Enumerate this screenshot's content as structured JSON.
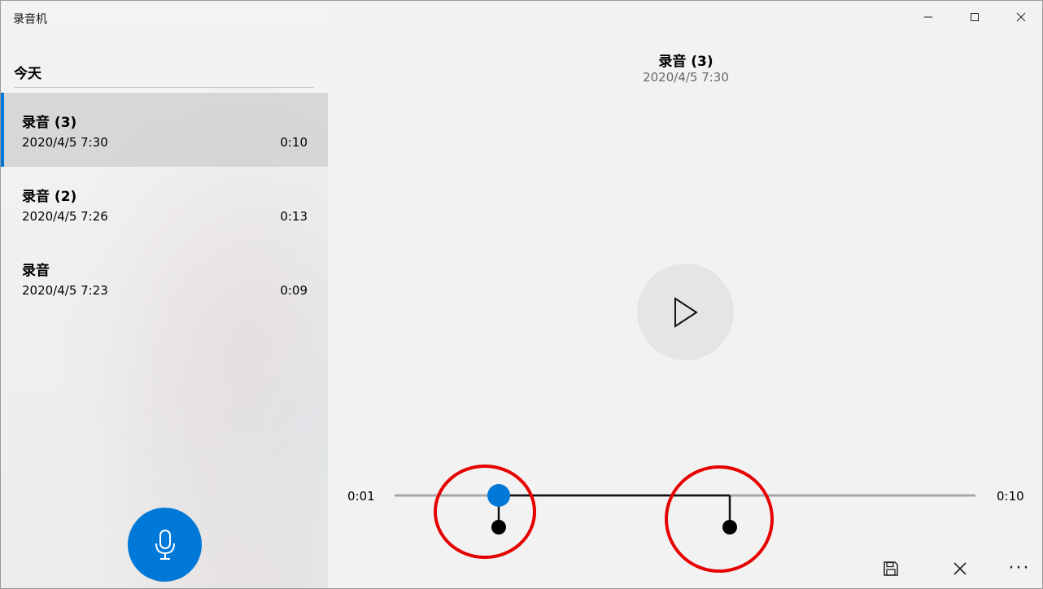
{
  "app": {
    "title": "录音机"
  },
  "sidebar": {
    "section_header": "今天",
    "recordings": [
      {
        "name": "录音 (3)",
        "date": "2020/4/5 7:30",
        "duration": "0:10",
        "selected": true
      },
      {
        "name": "录音 (2)",
        "date": "2020/4/5 7:26",
        "duration": "0:13",
        "selected": false
      },
      {
        "name": "录音",
        "date": "2020/4/5 7:23",
        "duration": "0:09",
        "selected": false
      }
    ],
    "record_button_icon": "microphone-icon"
  },
  "detail": {
    "title": "录音 (3)",
    "date": "2020/4/5 7:30",
    "play_icon": "play-icon"
  },
  "playback": {
    "current_time": "0:01",
    "total_time": "0:10",
    "progress_fraction": 0.18
  },
  "toolbar": {
    "icons": [
      "save-icon",
      "close-icon",
      "more-icon"
    ],
    "more_label": "···"
  },
  "colors": {
    "accent": "#0078d7",
    "annotation_circle": "#e60000"
  }
}
